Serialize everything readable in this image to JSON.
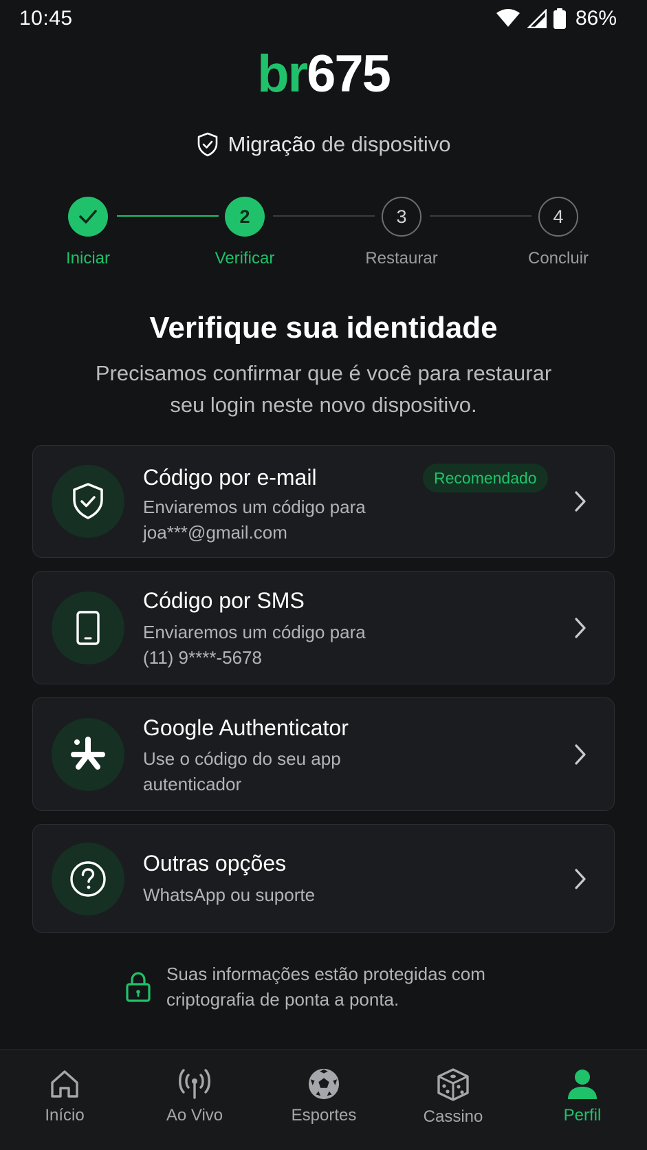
{
  "status_bar": {
    "time": "10:45",
    "battery": "86%"
  },
  "logo": {
    "part1": "br",
    "part2": "675"
  },
  "header": {
    "title_bold": "Migração",
    "title_rest": " de dispositivo"
  },
  "stepper": {
    "steps": [
      {
        "number": "",
        "label": "Iniciar"
      },
      {
        "number": "2",
        "label": "Verificar"
      },
      {
        "number": "3",
        "label": "Restaurar"
      },
      {
        "number": "4",
        "label": "Concluir"
      }
    ]
  },
  "heading": "Verifique sua identidade",
  "description": "Precisamos confirmar que é você para restaurar seu login neste novo dispositivo.",
  "options": [
    {
      "title": "Código por e-mail",
      "sub1": "Enviaremos um código para",
      "sub2": "joa***@gmail.com",
      "badge": "Recomendado",
      "icon": "shield-check-icon"
    },
    {
      "title": "Código por SMS",
      "sub1": "Enviaremos um código para",
      "sub2": "(11) 9****-5678",
      "icon": "phone-icon"
    },
    {
      "title": "Google Authenticator",
      "sub1": "Use o código do seu app",
      "sub2": "autenticador",
      "icon": "authenticator-icon"
    },
    {
      "title": "Outras opções",
      "sub1": "WhatsApp ou suporte",
      "icon": "help-circle-icon"
    }
  ],
  "security_note": {
    "line1": "Suas informações estão protegidas com",
    "line2": "criptografia de ponta a ponta."
  },
  "bottom_nav": [
    {
      "label": "Início",
      "icon": "home-icon"
    },
    {
      "label": "Ao Vivo",
      "icon": "live-broadcast-icon"
    },
    {
      "label": "Esportes",
      "icon": "soccer-ball-icon"
    },
    {
      "label": "Cassino",
      "icon": "dice-icon"
    },
    {
      "label": "Perfil",
      "icon": "profile-icon",
      "active": true
    }
  ],
  "colors": {
    "accent": "#1fc26b",
    "background": "#131416",
    "card": "#1a1c1f"
  }
}
